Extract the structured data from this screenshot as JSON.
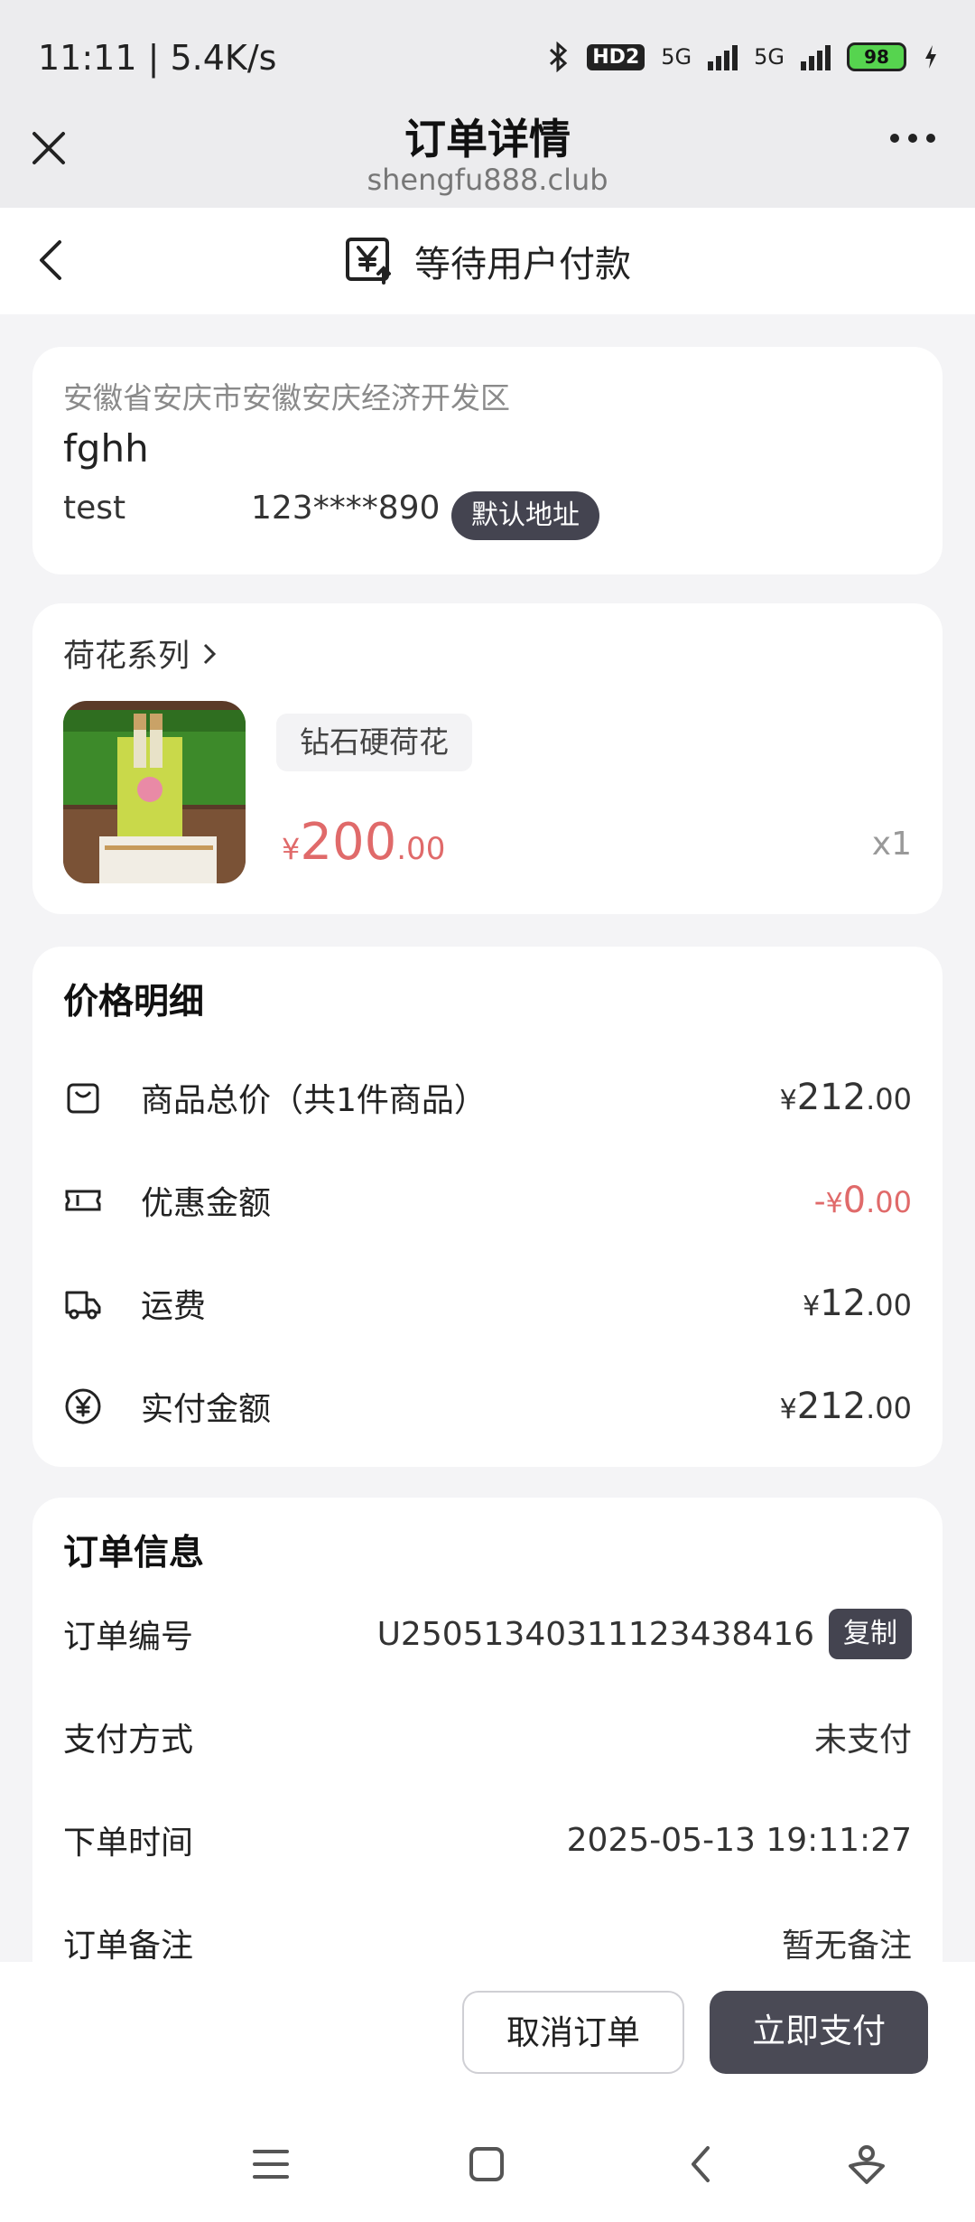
{
  "status_bar": {
    "time": "11:11 | 5.4K/s",
    "hd": "HD2",
    "sig1": "5G",
    "sig2": "5G",
    "battery": "98"
  },
  "browser": {
    "title": "订单详情",
    "url": "shengfu888.club"
  },
  "page_header": {
    "status_text": "等待用户付款"
  },
  "address": {
    "region": "安徽省安庆市安徽安庆经济开发区",
    "name": "fghh",
    "contact": "test",
    "phone": "123****890",
    "tag": "默认地址"
  },
  "product": {
    "series": "荷花系列",
    "spec": "钻石硬荷花",
    "price_currency": "¥",
    "price_int": "200",
    "price_dec": ".00",
    "quantity": "x1"
  },
  "price_details": {
    "title": "价格明细",
    "rows": [
      {
        "label": "商品总价（共1件商品）",
        "prefix": "",
        "cur": "¥",
        "int": "212",
        "dec": ".00",
        "icon": "bag-icon"
      },
      {
        "label": "优惠金额",
        "prefix": "-",
        "cur": "¥",
        "int": "0",
        "dec": ".00",
        "icon": "ticket-icon"
      },
      {
        "label": "运费",
        "prefix": "",
        "cur": "¥",
        "int": "12",
        "dec": ".00",
        "icon": "truck-icon"
      },
      {
        "label": "实付金额",
        "prefix": "",
        "cur": "¥",
        "int": "212",
        "dec": ".00",
        "icon": "yen-circle-icon"
      }
    ]
  },
  "order_info": {
    "title": "订单信息",
    "order_no_label": "订单编号",
    "order_no": "U2505134031112343841​6",
    "copy_label": "复制",
    "pay_method_label": "支付方式",
    "pay_method": "未支付",
    "time_label": "下单时间",
    "time": "2025-05-13 19:11:27",
    "remark_label": "订单备注",
    "remark": "暂无备注"
  },
  "actions": {
    "cancel": "取消订单",
    "pay": "立即支付"
  },
  "colors": {
    "accent_red": "#e06a6a",
    "dark_button": "#4a4a55"
  }
}
